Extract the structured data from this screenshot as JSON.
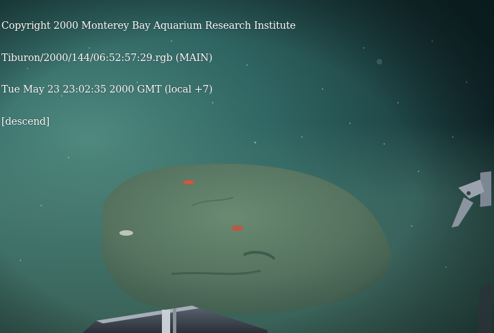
{
  "overlay": {
    "copyright": "Copyright 2000 Monterey Bay Aquarium Research Institute",
    "source": "Tiburon/2000/144/06:52:57:29.rgb (MAIN)",
    "datetime": "Tue May 23 23:02:35 2000 GMT (local +7)",
    "status": "[descend]"
  },
  "scene": {
    "water_color": "#2f6a66",
    "sediment_color": "#4f7a6b",
    "rock_color": "#5c7a66",
    "vignette_color": "#0f2526"
  }
}
